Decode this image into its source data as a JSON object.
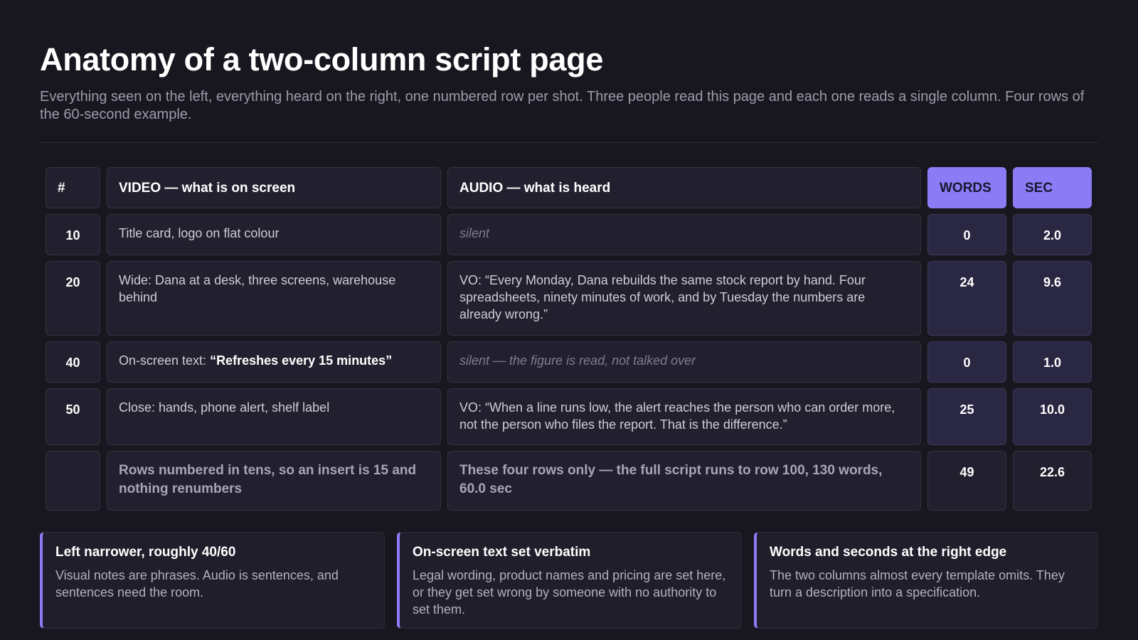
{
  "title": "Anatomy of a two-column script page",
  "subtitle": "Everything seen on the left, everything heard on the right, one numbered row per shot. Three people read this page and each one reads a single column. Four rows of the 60-second example.",
  "table": {
    "headers": {
      "num": "#",
      "video": "VIDEO — what is on screen",
      "audio": "AUDIO — what is heard",
      "words": "WORDS",
      "sec": "SEC"
    },
    "rows": [
      {
        "num": "10",
        "video": "Title card, logo on flat colour",
        "audio": "silent",
        "words": "0",
        "sec": "2.0"
      },
      {
        "num": "20",
        "video": "Wide: Dana at a desk, three screens, warehouse behind",
        "audio": "VO: “Every Monday, Dana rebuilds the same stock report by hand. Four spreadsheets, ninety minutes of work, and by Tuesday the numbers are already wrong.”",
        "words": "24",
        "sec": "9.6"
      },
      {
        "num": "40",
        "video_prefix": "On-screen text: ",
        "video_strong": "“Refreshes every 15 minutes”",
        "audio": "silent — the figure is read, not talked over",
        "words": "0",
        "sec": "1.0"
      },
      {
        "num": "50",
        "video": "Close: hands, phone alert, shelf label",
        "audio": "VO: “When a line runs low, the alert reaches the person who can order more, not the person who files the report. That is the difference.”",
        "words": "25",
        "sec": "10.0"
      }
    ],
    "total": {
      "num": "",
      "video": "Rows numbered in tens, so an insert is 15 and nothing renumbers",
      "audio": "These four rows only — the full script runs to row 100, 130 words, 60.0 sec",
      "words": "49",
      "sec": "22.6"
    }
  },
  "notes": [
    {
      "title": "Left narrower, roughly 40/60",
      "body": "Visual notes are phrases. Audio is sentences, and sentences need the room."
    },
    {
      "title": "On-screen text set verbatim",
      "body": "Legal wording, product names and pricing are set here, or they get set wrong by someone with no authority to set them."
    },
    {
      "title": "Words and seconds at the right edge",
      "body": "The two columns almost every template omits. They turn a description into a specification."
    }
  ],
  "colors": {
    "background": "#18171f",
    "accent": "#8b7cf6",
    "cell": "#22202e",
    "stat_cell": "#2a2743"
  }
}
